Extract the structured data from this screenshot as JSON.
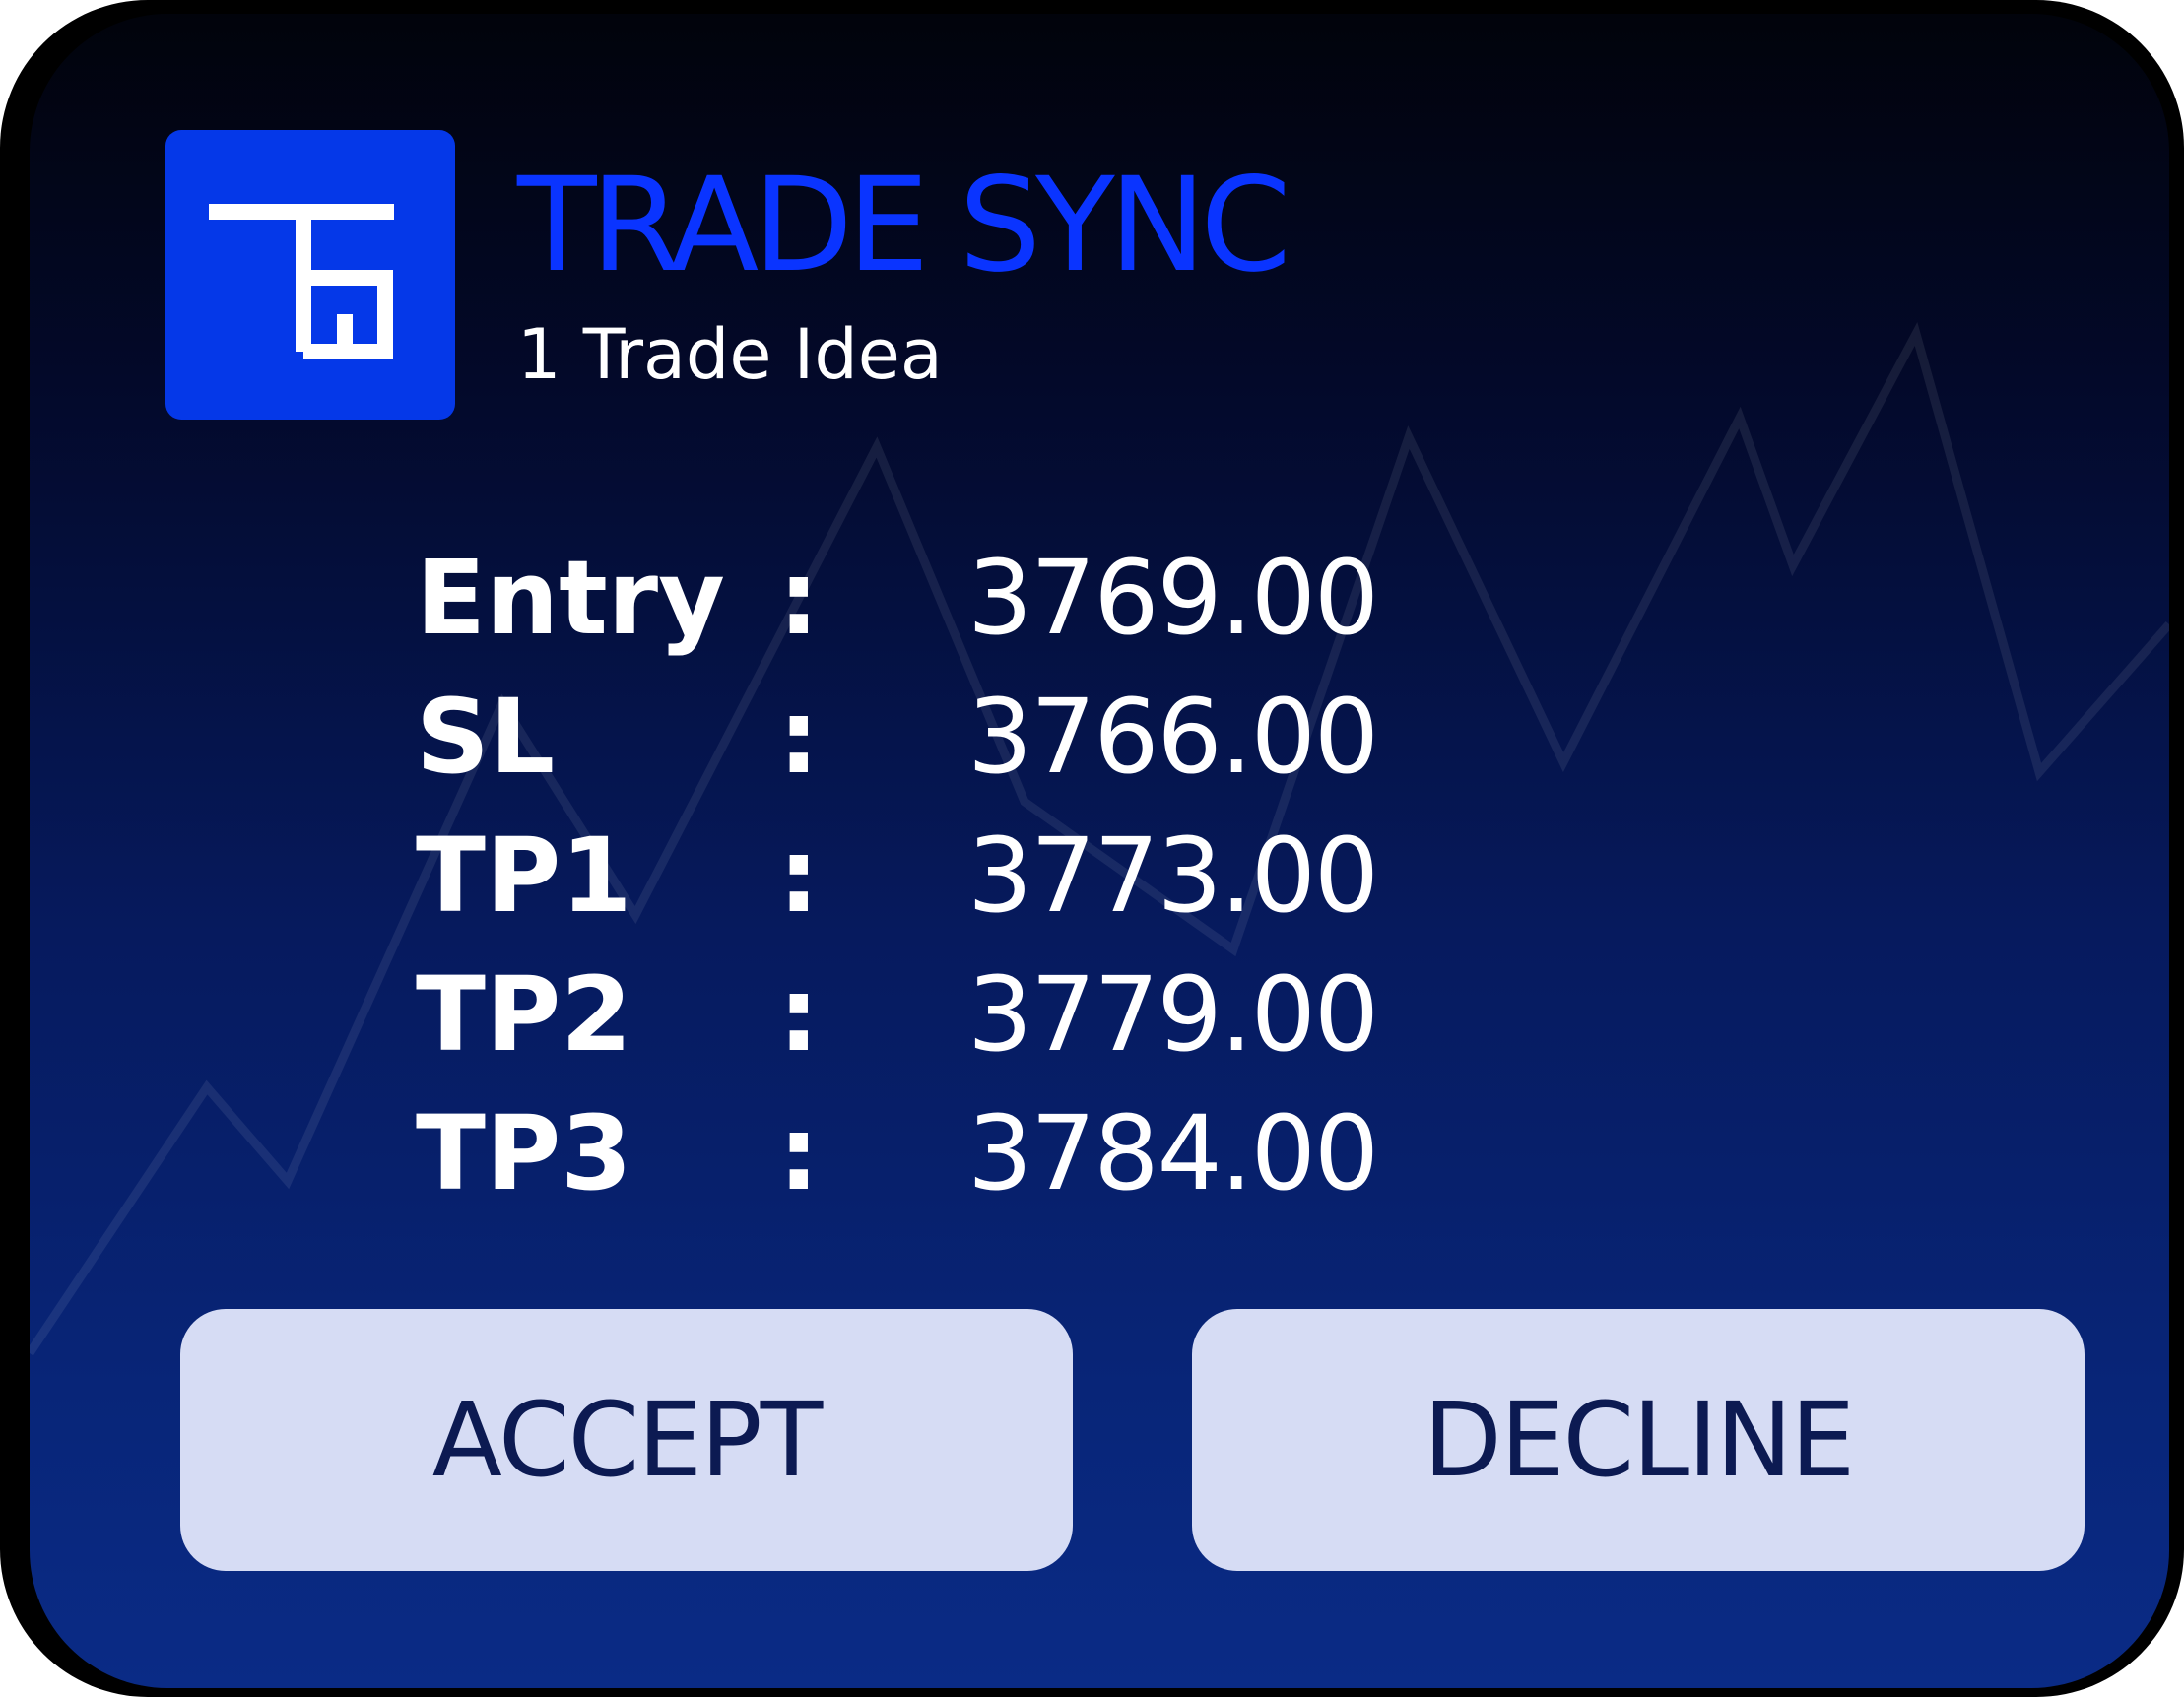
{
  "app": {
    "name": "TRADE SYNC",
    "subtitle": "1 Trade Idea",
    "logo_text": "TS",
    "logo_color": "#0538e8",
    "title_color": "#0a34ff"
  },
  "trade": {
    "levels": [
      {
        "label": "Entry",
        "separator": ":",
        "value": "3769.00"
      },
      {
        "label": "SL",
        "separator": ":",
        "value": "3766.00"
      },
      {
        "label": "TP1",
        "separator": ":",
        "value": "3773.00"
      },
      {
        "label": "TP2",
        "separator": ":",
        "value": "3779.00"
      },
      {
        "label": "TP3",
        "separator": ":",
        "value": "3784.00"
      }
    ]
  },
  "actions": {
    "accept_label": "ACCEPT",
    "decline_label": "DECLINE"
  },
  "background": {
    "decoration": "zigzag-chart-line",
    "gradient_top": "#01030b",
    "gradient_bottom": "#0a2b86"
  }
}
